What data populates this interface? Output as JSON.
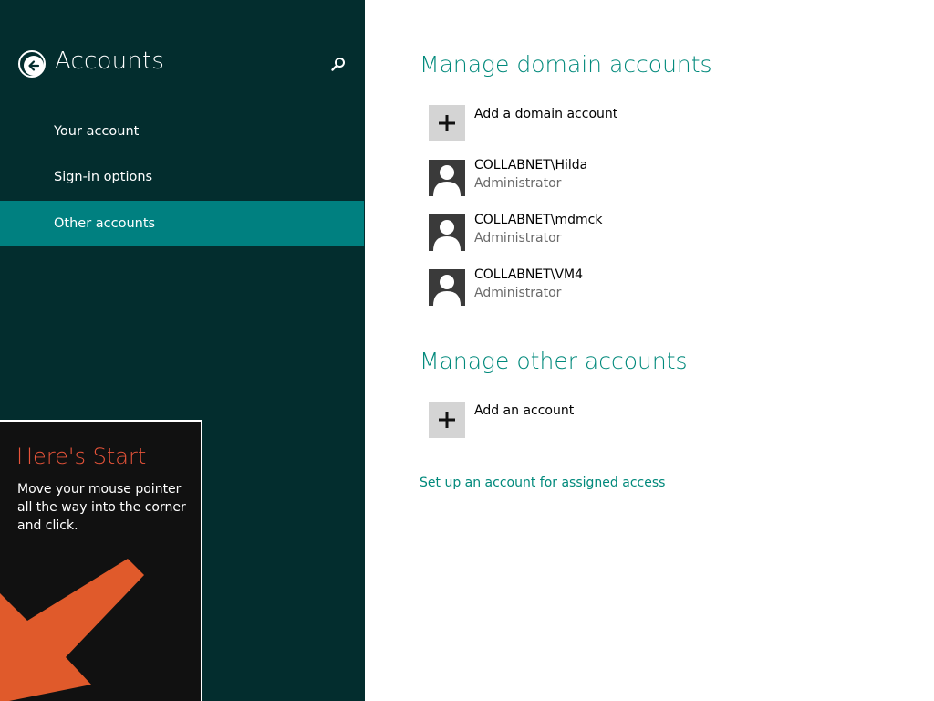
{
  "header": {
    "title": "Accounts"
  },
  "nav": {
    "items": [
      {
        "label": "Your account"
      },
      {
        "label": "Sign-in options"
      },
      {
        "label": "Other accounts"
      }
    ]
  },
  "tip": {
    "title": "Here's Start",
    "body": "Move your mouse pointer all the way into the corner and click."
  },
  "domain_section": {
    "heading": "Manage domain accounts",
    "add_label": "Add a domain account",
    "accounts": [
      {
        "name": "COLLABNET\\Hilda",
        "role": "Administrator"
      },
      {
        "name": "COLLABNET\\mdmck",
        "role": "Administrator"
      },
      {
        "name": "COLLABNET\\VM4",
        "role": "Administrator"
      }
    ]
  },
  "other_section": {
    "heading": "Manage other accounts",
    "add_label": "Add an account"
  },
  "assigned_access_link": "Set up an account for assigned access",
  "colors": {
    "pane_background": "#032d2e",
    "selected_item": "#008080",
    "accent": "#00897b",
    "tip_title": "#e8543a",
    "tip_arrow": "#e05a2b"
  },
  "icons": {
    "back": "back-arrow-icon",
    "search": "search-icon",
    "add": "plus-icon",
    "user": "user-icon",
    "tip_arrow": "arrow-down-left-icon"
  },
  "nav_selected_index": 2
}
